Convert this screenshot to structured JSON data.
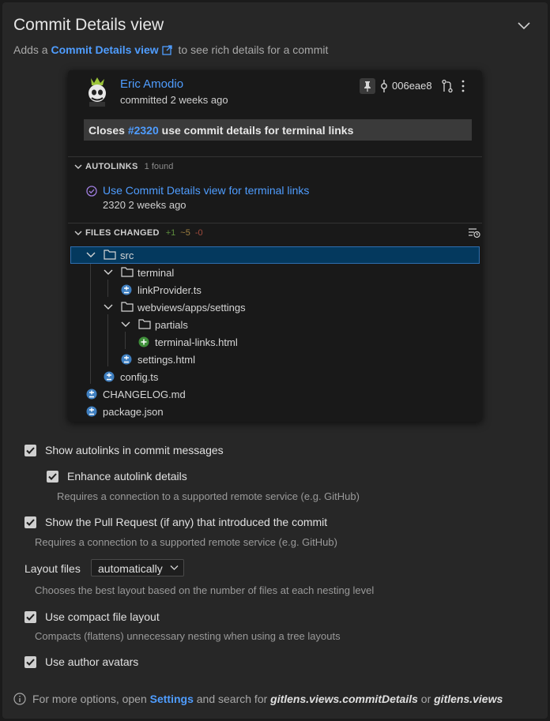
{
  "header": {
    "title": "Commit Details view",
    "subtitle_prefix": "Adds a",
    "subtitle_link": "Commit Details view",
    "subtitle_suffix": "to see rich details for a commit"
  },
  "preview": {
    "author": "Eric Amodio",
    "committed": "committed 2 weeks ago",
    "sha": "006eae8",
    "message_prefix": "Closes",
    "message_issue": "#2320",
    "message_suffix": "use commit details for terminal links",
    "autolinks": {
      "heading": "AUTOLINKS",
      "count": "1 found",
      "item_title": "Use Commit Details view for terminal links",
      "item_meta": "2320 2 weeks ago"
    },
    "files_changed": {
      "heading": "FILES CHANGED",
      "added": "+1",
      "modified": "~5",
      "deleted": "-0",
      "tree": [
        {
          "label": "src"
        },
        {
          "label": "terminal"
        },
        {
          "label": "linkProvider.ts"
        },
        {
          "label": "webviews/apps/settings"
        },
        {
          "label": "partials"
        },
        {
          "label": "terminal-links.html"
        },
        {
          "label": "settings.html"
        },
        {
          "label": "config.ts"
        },
        {
          "label": "CHANGELOG.md"
        },
        {
          "label": "package.json"
        }
      ]
    }
  },
  "settings": {
    "show_autolinks": {
      "label": "Show autolinks in commit messages",
      "checked": true
    },
    "enhance_autolinks": {
      "label": "Enhance autolink details",
      "checked": true,
      "description": "Requires a connection to a supported remote service (e.g. GitHub)"
    },
    "show_pr": {
      "label": "Show the Pull Request (if any) that introduced the commit",
      "checked": true,
      "description": "Requires a connection to a supported remote service (e.g. GitHub)"
    },
    "layout_files": {
      "label": "Layout files",
      "value": "automatically",
      "description": "Chooses the best layout based on the number of files at each nesting level"
    },
    "compact_layout": {
      "label": "Use compact file layout",
      "checked": true,
      "description": "Compacts (flattens) unnecessary nesting when using a tree layouts"
    },
    "author_avatars": {
      "label": "Use author avatars",
      "checked": true
    }
  },
  "footer": {
    "prefix": "For more options, open",
    "link": "Settings",
    "middle": "and search for",
    "term1": "gitlens.views.commitDetails",
    "or": "or",
    "term2": "gitlens.views"
  },
  "colors": {
    "accent": "#4f9dff",
    "panel": "#272727",
    "card": "#191919",
    "selected": "#04395e"
  }
}
